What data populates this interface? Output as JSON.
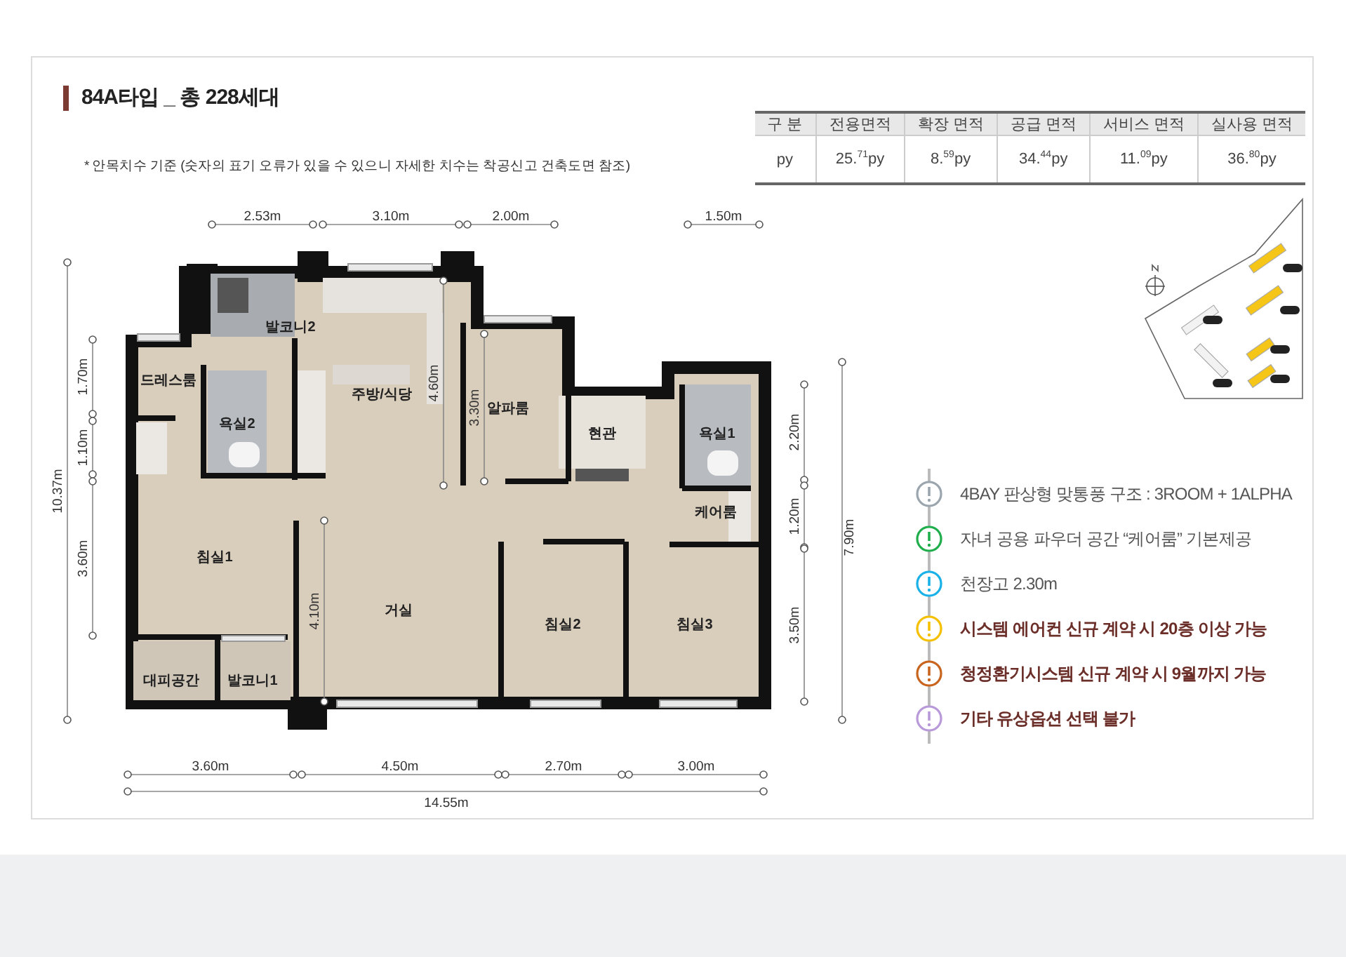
{
  "title": "84A타입 _ 총 228세대",
  "note": "* 안목치수 기준 (숫자의 표기 오류가 있을 수 있으니 자세한 치수는 착공신고 건축도면 참조)",
  "area_table": {
    "columns": [
      "구 분",
      "전용면적",
      "확장 면적",
      "공급 면적",
      "서비스 면적",
      "실사용 면적"
    ],
    "rows": [
      [
        "py",
        "25.$^{71}$py",
        "8.$^{59}$py",
        "34.$^{44}$py",
        "11.$^{09}$py",
        "36.$^{80}$py"
      ]
    ]
  },
  "floor_plan": {
    "rooms": [
      "발코니2",
      "드레스룸",
      "주방/식당",
      "알파룸",
      "욕실2",
      "현관",
      "욕실1",
      "케어룸",
      "침실1",
      "거실",
      "침실2",
      "침실3",
      "대피공간",
      "발코니1"
    ],
    "dimensions": {
      "top": [
        "2.53m",
        "3.10m",
        "2.00m",
        "1.50m"
      ],
      "bottom": [
        "3.60m",
        "4.50m",
        "2.70m",
        "3.00m"
      ],
      "total": "14.55m",
      "left_outer": "10.37m",
      "left": [
        "1.70m",
        "1.10m",
        "3.60m"
      ],
      "right": [
        "2.20m",
        "1.20m",
        "3.50m"
      ],
      "right_outer": "7.90m",
      "interior": [
        "4.60m",
        "3.30m",
        "4.10m"
      ]
    }
  },
  "features": [
    {
      "text": "4BAY 판상형 맞통풍 구조 : 3ROOM + 1ALPHA",
      "color": "#9aa5ae",
      "emphasis": false
    },
    {
      "text": "자녀 공용 파우더 공간 “케어룸” 기본제공",
      "color": "#1fae4b",
      "emphasis": false
    },
    {
      "text": "천장고 2.30m",
      "color": "#1ab0e8",
      "emphasis": false
    },
    {
      "text": "시스템 에어컨 신규 계약 시 20층 이상 가능",
      "color": "#f5c000",
      "emphasis": true
    },
    {
      "text": "청정환기시스템 신규 계약 시 9월까지 가능",
      "color": "#c8641e",
      "emphasis": true
    },
    {
      "text": "기타 유상옵션 선택 불가",
      "color": "#b899d9",
      "emphasis": true
    }
  ]
}
